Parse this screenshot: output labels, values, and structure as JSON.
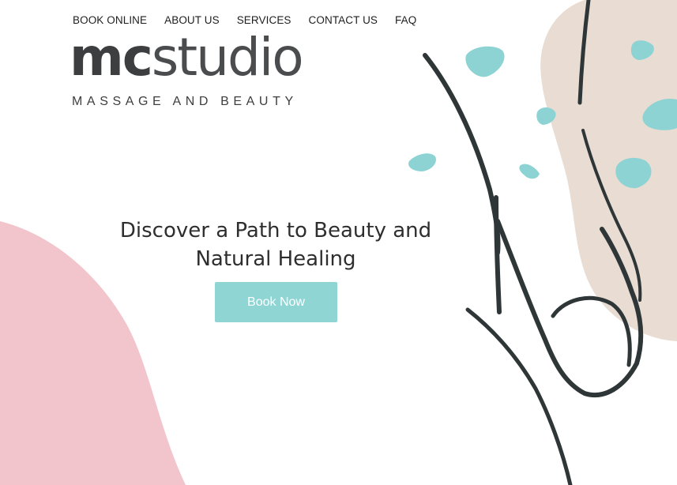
{
  "nav": {
    "items": [
      {
        "label": "BOOK ONLINE"
      },
      {
        "label": "ABOUT US"
      },
      {
        "label": "SERVICES"
      },
      {
        "label": "CONTACT US"
      },
      {
        "label": "FAQ"
      }
    ]
  },
  "logo": {
    "word_bold": "mc",
    "word_light": "studio",
    "tagline": "MASSAGE AND BEAUTY"
  },
  "hero": {
    "title_line1": "Discover a Path to Beauty and",
    "title_line2": "Natural Healing",
    "cta_label": "Book Now"
  },
  "colors": {
    "accent": "#8fd5d4",
    "pink_blob": "#f2c4cb",
    "beige_blob": "#e8dcd3",
    "teal_leaf": "#8dd3d4",
    "line_drawing": "#2f3638",
    "text": "#2e2e2e"
  }
}
